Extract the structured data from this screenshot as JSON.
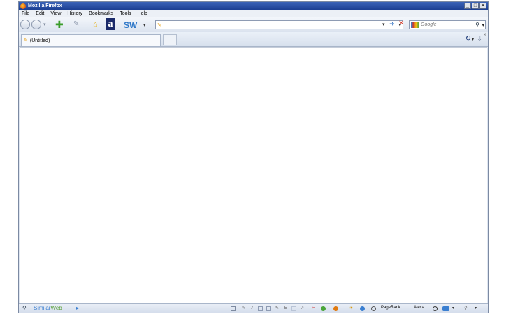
{
  "window": {
    "title": "Mozilla Firefox",
    "controls": {
      "minimize": "_",
      "maximize": "□",
      "close": "✕"
    }
  },
  "menu": {
    "items": [
      "File",
      "Edit",
      "View",
      "History",
      "Bookmarks",
      "Tools",
      "Help"
    ]
  },
  "toolbar": {
    "sw_label": "SW",
    "a_label": "a",
    "url_value": "",
    "search_placeholder": "Google"
  },
  "tabs": [
    {
      "label": "(Untitled)"
    }
  ],
  "statusbar": {
    "similarweb_part1": "Similar",
    "similarweb_part2": "Web",
    "pagerank_label": "PageRank",
    "alexa_label": "Alexa"
  },
  "colors": {
    "titlebar": "#1c3f93",
    "similarweb_blue": "#3a7fd1",
    "similarweb_green": "#5aa03a",
    "sw_blue": "#2f78c8",
    "close_red": "#d23a2a"
  },
  "icons": {
    "back": "back-icon",
    "forward": "forward-icon",
    "add": "add-icon",
    "home": "home-icon",
    "go": "go-icon",
    "stop": "stop-icon",
    "search_engine": "google-icon",
    "search": "magnifier-icon"
  }
}
